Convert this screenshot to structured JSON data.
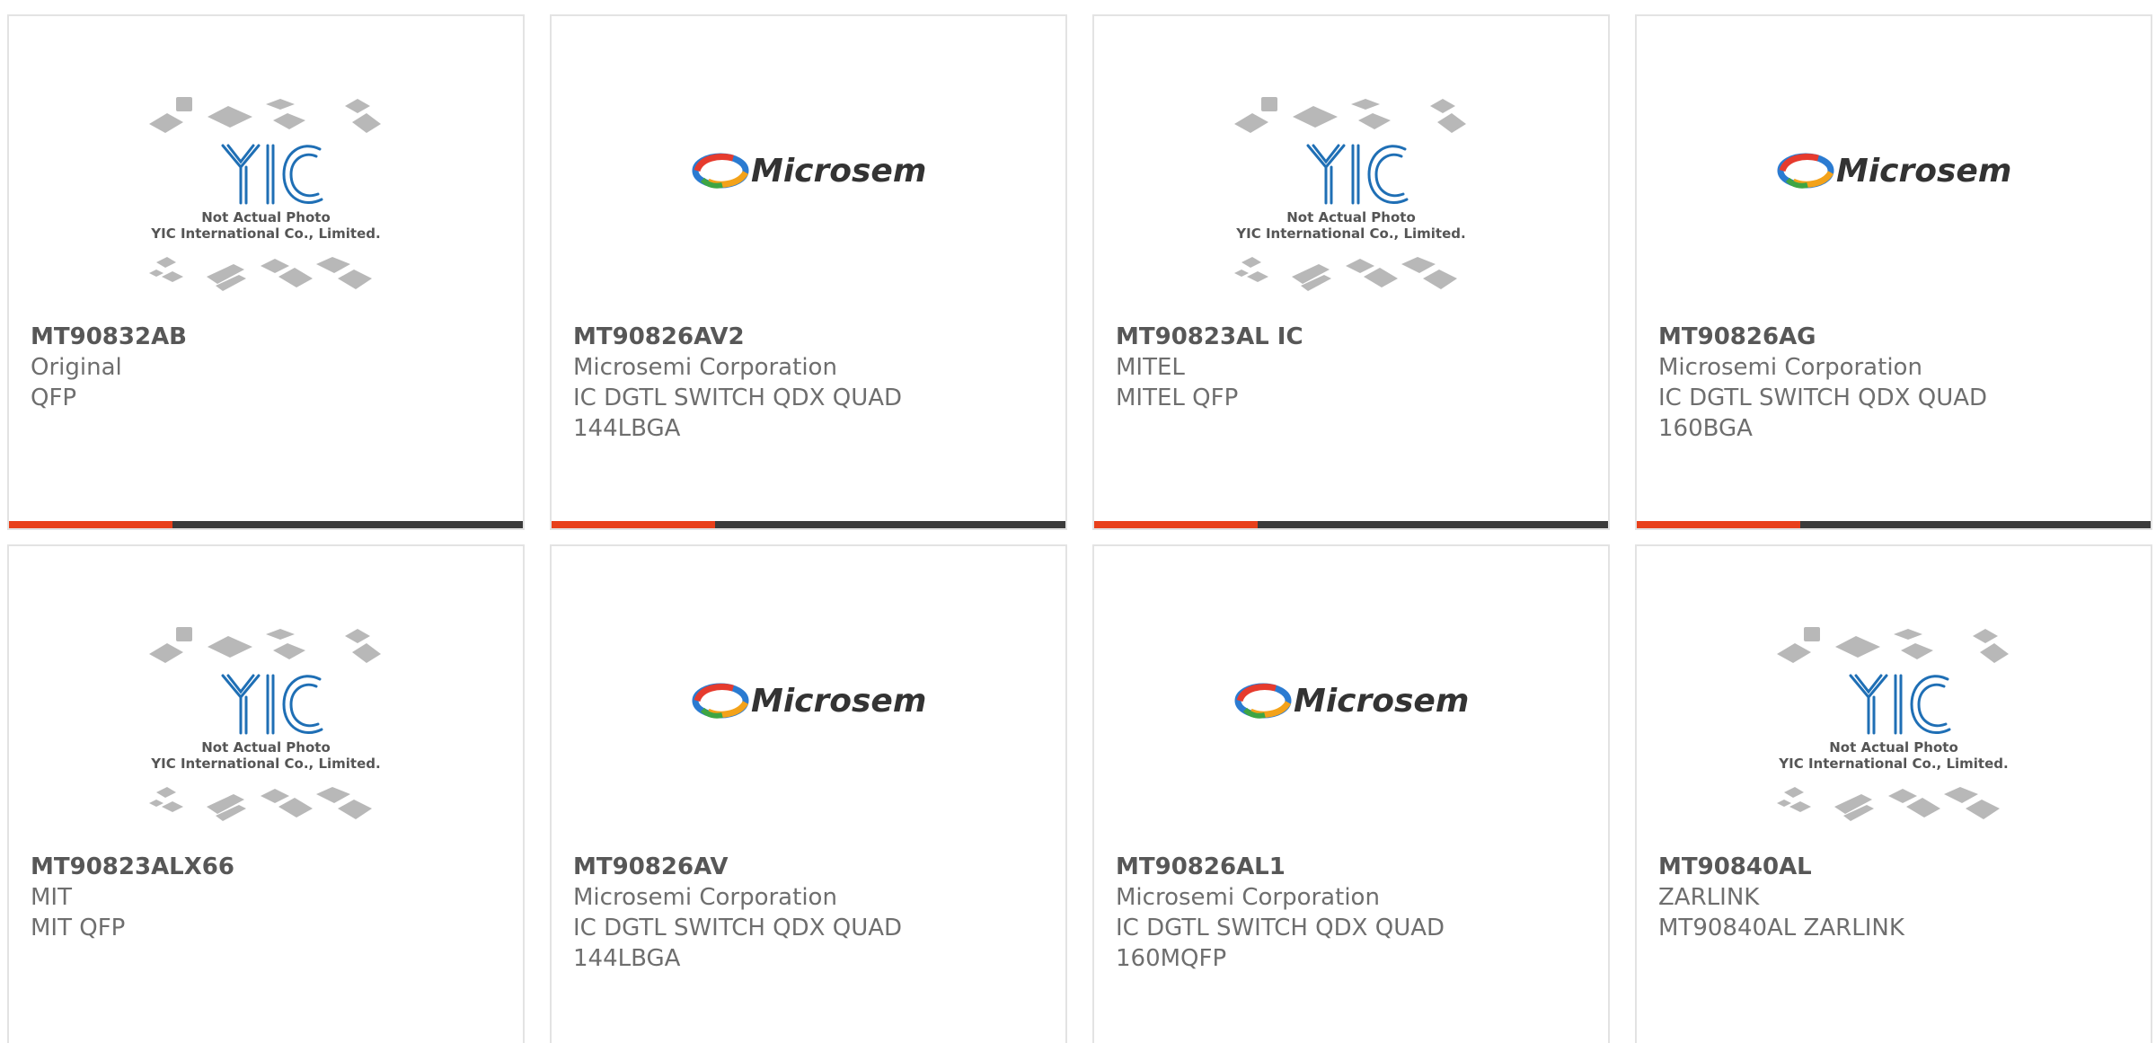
{
  "colors": {
    "accent": "#e8401b",
    "bar": "#3b3b3b",
    "border": "#e3e3e3",
    "text_strong": "#575757",
    "text": "#6e6e6e",
    "yic_blue": "#1f6fb5"
  },
  "yic_logo": {
    "text": "YIC",
    "line1": "Not Actual Photo",
    "line2": "YIC International Co., Limited."
  },
  "microsemi_logo": {
    "text": "Microsemi"
  },
  "products": [
    {
      "part_number": "MT90832AB",
      "lines": [
        "Original",
        "QFP"
      ],
      "image": "yic-placeholder"
    },
    {
      "part_number": "MT90826AV2",
      "lines": [
        "Microsemi Corporation",
        "IC DGTL SWITCH QDX QUAD",
        "144LBGA"
      ],
      "image": "microsemi-logo"
    },
    {
      "part_number": "MT90823AL IC",
      "lines": [
        "MITEL",
        "MITEL QFP"
      ],
      "image": "yic-placeholder"
    },
    {
      "part_number": "MT90826AG",
      "lines": [
        "Microsemi Corporation",
        "IC DGTL SWITCH QDX QUAD",
        "160BGA"
      ],
      "image": "microsemi-logo"
    },
    {
      "part_number": "MT90823ALX66",
      "lines": [
        "MIT",
        "MIT QFP"
      ],
      "image": "yic-placeholder"
    },
    {
      "part_number": "MT90826AV",
      "lines": [
        "Microsemi Corporation",
        "IC DGTL SWITCH QDX QUAD",
        "144LBGA"
      ],
      "image": "microsemi-logo"
    },
    {
      "part_number": "MT90826AL1",
      "lines": [
        "Microsemi Corporation",
        "IC DGTL SWITCH QDX QUAD",
        "160MQFP"
      ],
      "image": "microsemi-logo"
    },
    {
      "part_number": "MT90840AL",
      "lines": [
        "ZARLINK",
        "MT90840AL ZARLINK"
      ],
      "image": "yic-placeholder"
    }
  ]
}
